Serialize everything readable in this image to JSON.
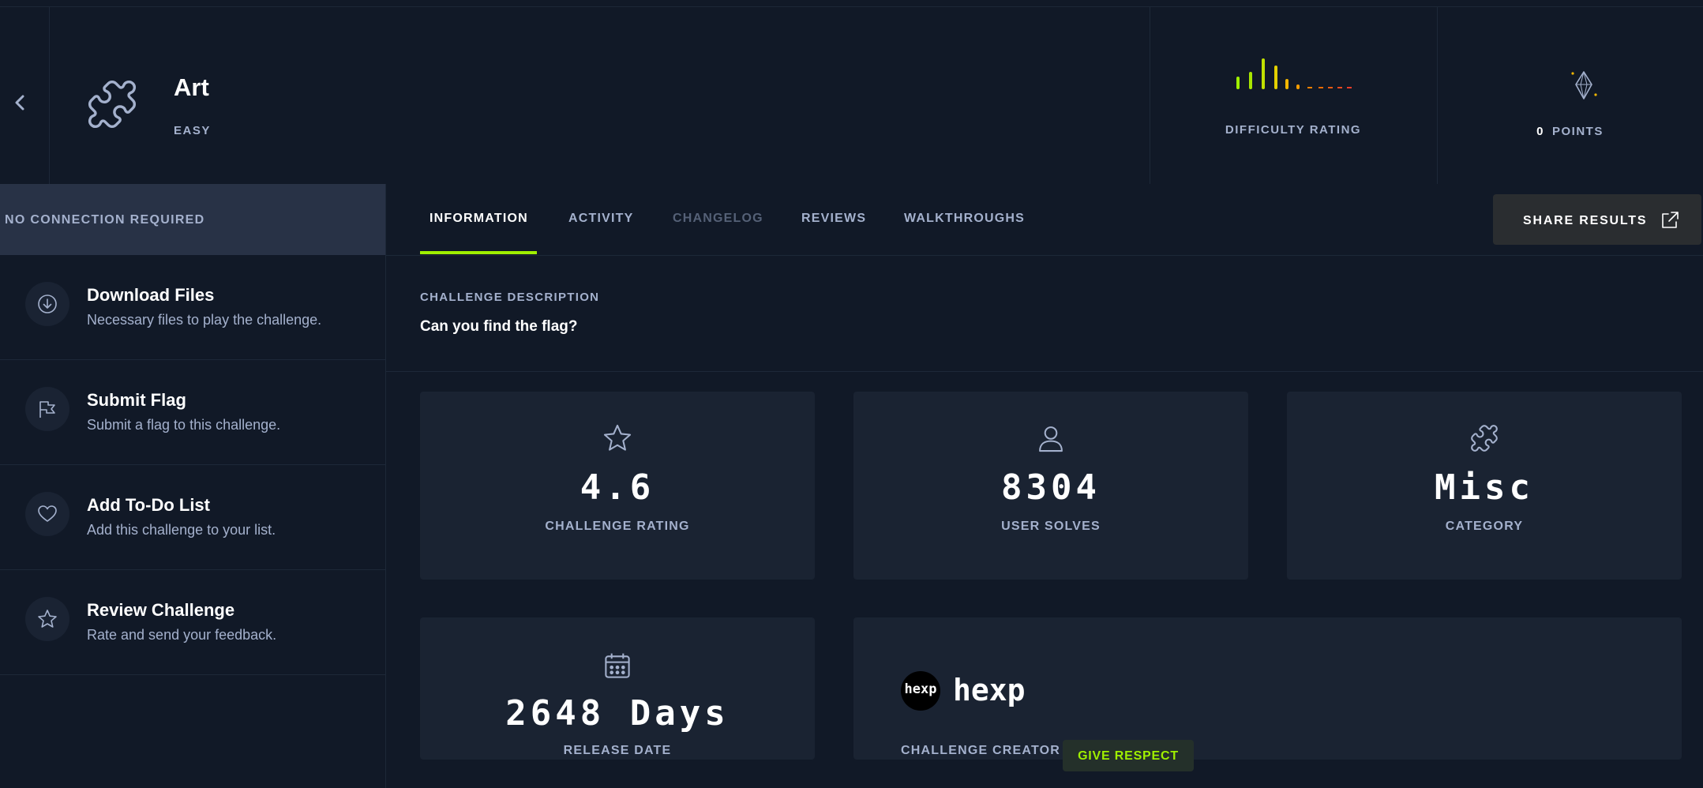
{
  "challenge": {
    "title": "Art",
    "difficulty": "EASY",
    "difficulty_rating_label": "DIFFICULTY RATING",
    "points_value": "0",
    "points_label": "POINTS"
  },
  "sidebar": {
    "connection_banner": "NO CONNECTION REQUIRED",
    "items": [
      {
        "title": "Download Files",
        "desc": "Necessary files to play the challenge.",
        "icon": "download-icon"
      },
      {
        "title": "Submit Flag",
        "desc": "Submit a flag to this challenge.",
        "icon": "flag-icon"
      },
      {
        "title": "Add To-Do List",
        "desc": "Add this challenge to your list.",
        "icon": "heart-icon"
      },
      {
        "title": "Review Challenge",
        "desc": "Rate and send your feedback.",
        "icon": "star-icon"
      }
    ]
  },
  "tabs": [
    {
      "label": "INFORMATION",
      "state": "active"
    },
    {
      "label": "ACTIVITY",
      "state": "normal"
    },
    {
      "label": "CHANGELOG",
      "state": "disabled"
    },
    {
      "label": "REVIEWS",
      "state": "normal"
    },
    {
      "label": "WALKTHROUGHS",
      "state": "normal"
    }
  ],
  "share_label": "SHARE RESULTS",
  "description": {
    "heading": "CHALLENGE DESCRIPTION",
    "text": "Can you find the flag?"
  },
  "stats": {
    "rating": {
      "value": "4.6",
      "label": "CHALLENGE RATING"
    },
    "solves": {
      "value": "8304",
      "label": "USER SOLVES"
    },
    "category": {
      "value": "Misc",
      "label": "CATEGORY"
    },
    "release": {
      "value": "2648 Days",
      "label": "RELEASE DATE"
    }
  },
  "creator": {
    "avatar_text": "hexp",
    "name": "hexp",
    "label": "CHALLENGE CREATOR",
    "respect_label": "GIVE RESPECT"
  },
  "colors": {
    "background": "#111927",
    "card": "#1a2332",
    "accent_green": "#9fef00",
    "muted_text": "#a4b1cd",
    "difficulty_bars": [
      "#9fef00",
      "#a8e600",
      "#c1e000",
      "#e3d000",
      "#f2b600",
      "#f59c00",
      "#f08000",
      "#ec6a00",
      "#e95a14",
      "#e84a20",
      "#e63c2a"
    ]
  }
}
